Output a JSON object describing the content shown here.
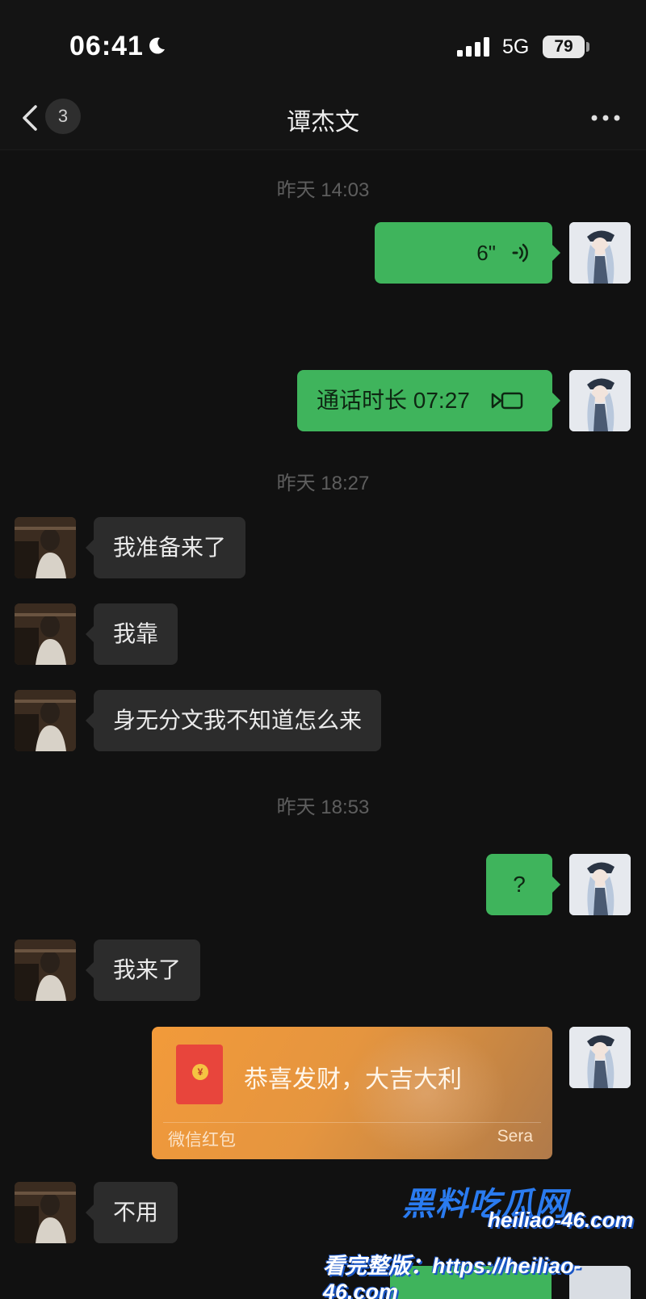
{
  "status_bar": {
    "time": "06:41",
    "network": "5G",
    "battery": "79"
  },
  "nav": {
    "unread_count": "3",
    "title": "谭杰文",
    "back_icon": "chevron-left-icon",
    "more_icon": "more-horizontal-icon"
  },
  "timestamps": [
    "昨天 14:03",
    "昨天 18:27",
    "昨天 18:53"
  ],
  "messages": [
    {
      "from": "self",
      "type": "voice",
      "duration": "6\""
    },
    {
      "from": "self",
      "type": "call",
      "text": "通话时长 07:27"
    },
    {
      "from": "contact",
      "type": "text",
      "text": "我准备来了"
    },
    {
      "from": "contact",
      "type": "text",
      "text": "我靠"
    },
    {
      "from": "contact",
      "type": "text",
      "text": "身无分文我不知道怎么来"
    },
    {
      "from": "self",
      "type": "text",
      "text": "?"
    },
    {
      "from": "contact",
      "type": "text",
      "text": "我来了"
    },
    {
      "from": "self",
      "type": "red_packet",
      "greeting": "恭喜发财，大吉大利",
      "label": "微信红包",
      "sender": "Sera"
    },
    {
      "from": "contact",
      "type": "text",
      "text": "不用"
    }
  ],
  "watermark": {
    "title": "黑料吃瓜网",
    "domain": "heiliao-46.com",
    "cta": "看完整版：https://heiliao-46.com"
  },
  "colors": {
    "background": "#111111",
    "outgoing_bubble": "#3fb45c",
    "incoming_bubble": "#2c2c2c",
    "red_packet": "#f29a3a",
    "watermark_blue": "#2a7bf0"
  }
}
